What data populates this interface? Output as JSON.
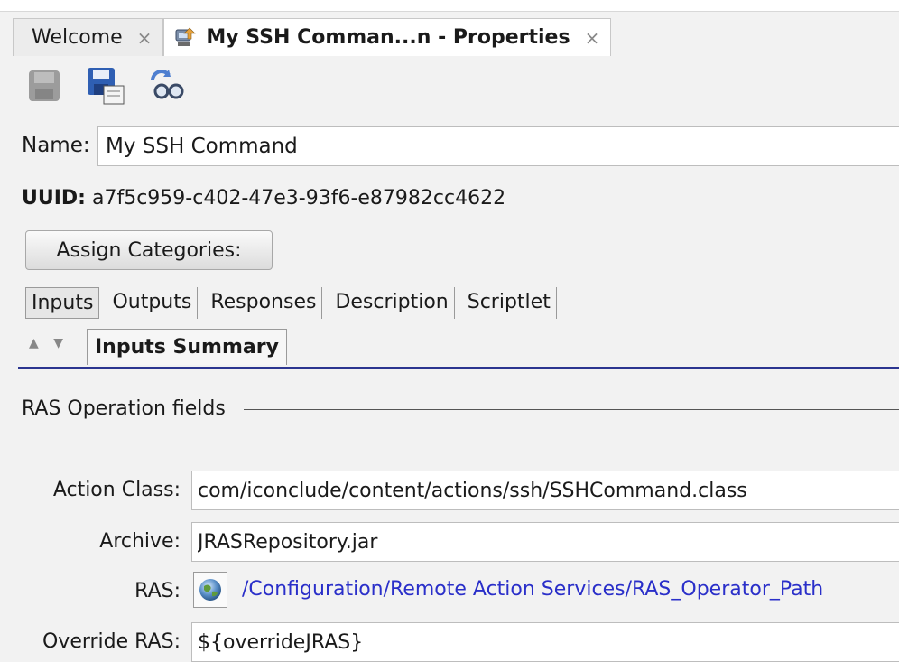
{
  "tabs": [
    {
      "label": "Welcome",
      "close": "×",
      "active": false
    },
    {
      "label": "My SSH Comman...n - Properties",
      "close": "×",
      "active": true
    }
  ],
  "toolbar": [
    {
      "icon": "save-disabled-icon"
    },
    {
      "icon": "save-as-icon"
    },
    {
      "icon": "find-references-icon"
    }
  ],
  "name": {
    "label": "Name:",
    "value": "My SSH Command"
  },
  "uuid": {
    "label": "UUID:",
    "value": "a7f5c959-c402-47e3-93f6-e87982cc4622"
  },
  "assign_button": "Assign Categories:",
  "inner_tabs": [
    "Inputs",
    "Outputs",
    "Responses",
    "Description",
    "Scriptlet"
  ],
  "summary_arrows": "▲ ▼",
  "summary_tab": "Inputs Summary",
  "fieldset": {
    "title": "RAS Operation fields",
    "action_class": {
      "label": "Action Class:",
      "value": "com/iconclude/content/actions/ssh/SSHCommand.class"
    },
    "archive": {
      "label": "Archive:",
      "value": "JRASRepository.jar"
    },
    "ras": {
      "label": "RAS:",
      "link": "/Configuration/Remote Action Services/RAS_Operator_Path"
    },
    "override_ras": {
      "label": "Override RAS:",
      "value": "${overrideJRAS}"
    }
  },
  "colors": {
    "accent": "#2b3590",
    "link": "#2a2fc9"
  }
}
